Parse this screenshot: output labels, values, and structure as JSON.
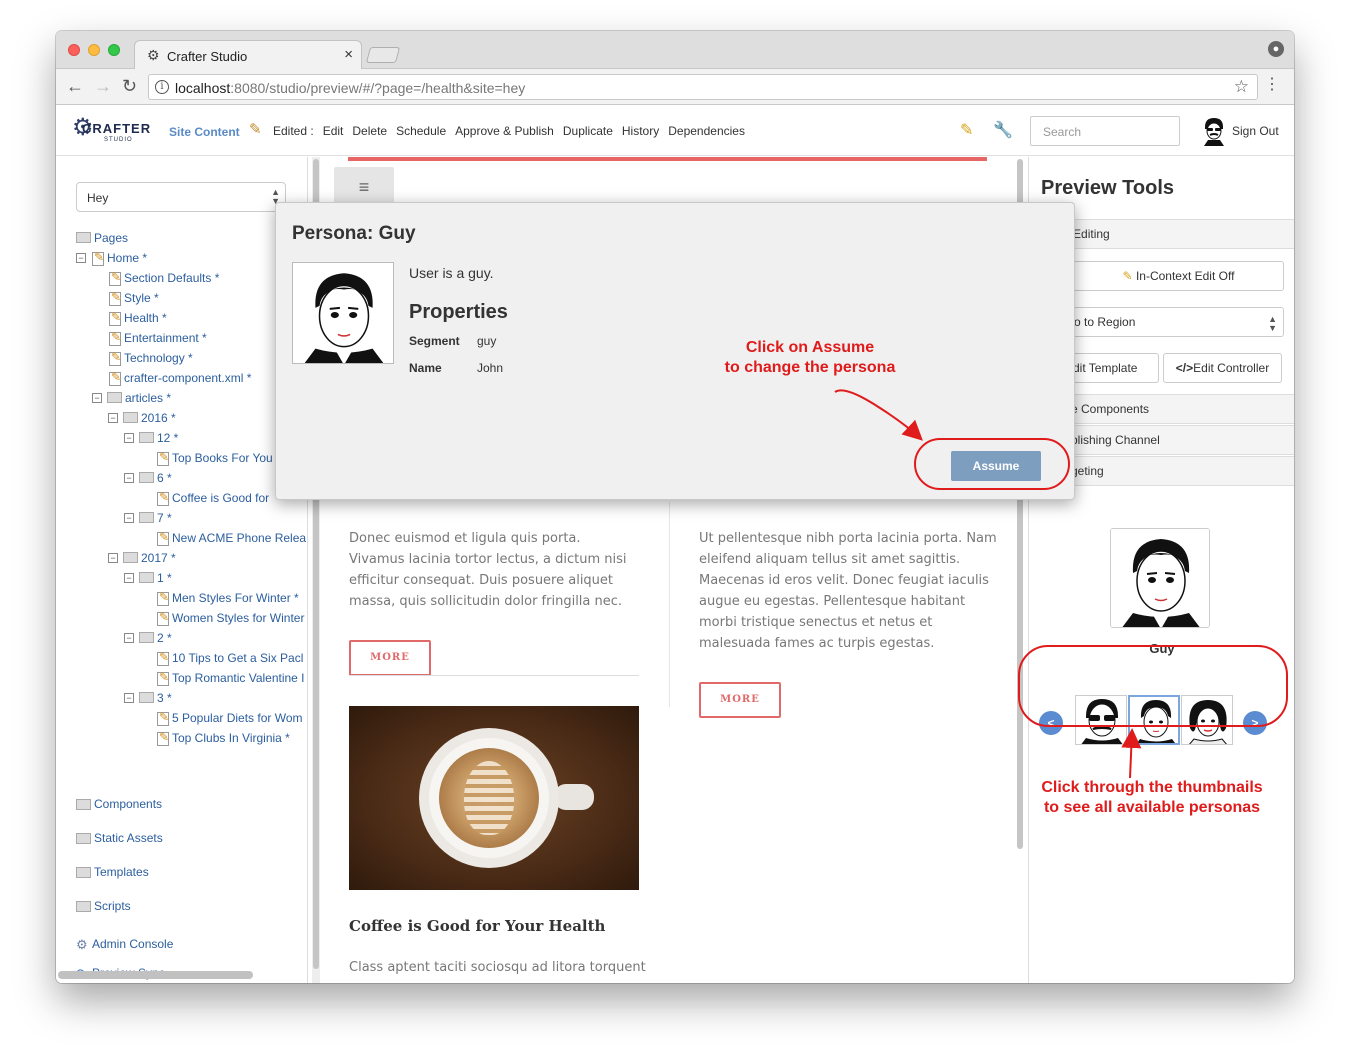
{
  "browser": {
    "tab_title": "Crafter Studio",
    "tab_close": "×",
    "url_host": "localhost",
    "url_rest": ":8080/studio/preview/#/?page=/health&site=hey",
    "info_glyph": "i",
    "star_glyph": "☆",
    "menu_glyph": "⋮",
    "back_glyph": "←",
    "forward_glyph": "→",
    "reload_glyph": "C"
  },
  "studio": {
    "logo_text": "CRAFTER",
    "logo_sub": "STUDIO",
    "site_content": "Site Content",
    "toolbar": [
      "Edited :",
      "Edit",
      "Delete",
      "Schedule",
      "Approve & Publish",
      "Duplicate",
      "History",
      "Dependencies"
    ],
    "search_placeholder": "Search",
    "sign_out": "Sign Out"
  },
  "sidebar": {
    "site_value": "Hey",
    "tree": [
      {
        "label": "Pages",
        "type": "folder",
        "level": 0,
        "expander": ""
      },
      {
        "label": "Home *",
        "type": "page",
        "level": 0,
        "expander": "−"
      },
      {
        "label": "Section Defaults *",
        "type": "page",
        "level": 1,
        "expander": ""
      },
      {
        "label": "Style *",
        "type": "page",
        "level": 1,
        "expander": ""
      },
      {
        "label": "Health *",
        "type": "page",
        "level": 1,
        "expander": ""
      },
      {
        "label": "Entertainment *",
        "type": "page",
        "level": 1,
        "expander": ""
      },
      {
        "label": "Technology *",
        "type": "page",
        "level": 1,
        "expander": ""
      },
      {
        "label": "crafter-component.xml *",
        "type": "page",
        "level": 1,
        "expander": ""
      },
      {
        "label": "articles *",
        "type": "folder",
        "level": 1,
        "expander": "−"
      },
      {
        "label": "2016 *",
        "type": "folder",
        "level": 2,
        "expander": "−"
      },
      {
        "label": "12 *",
        "type": "folder",
        "level": 3,
        "expander": "−"
      },
      {
        "label": "Top Books For You",
        "type": "page",
        "level": 4,
        "expander": ""
      },
      {
        "label": "6 *",
        "type": "folder",
        "level": 3,
        "expander": "−"
      },
      {
        "label": "Coffee is Good for",
        "type": "page",
        "level": 4,
        "expander": ""
      },
      {
        "label": "7 *",
        "type": "folder",
        "level": 3,
        "expander": "−"
      },
      {
        "label": "New ACME Phone Relea",
        "type": "page",
        "level": 4,
        "expander": ""
      },
      {
        "label": "2017 *",
        "type": "folder",
        "level": 2,
        "expander": "−"
      },
      {
        "label": "1 *",
        "type": "folder",
        "level": 3,
        "expander": "−"
      },
      {
        "label": "Men Styles For Winter *",
        "type": "page",
        "level": 4,
        "expander": ""
      },
      {
        "label": "Women Styles for Winter",
        "type": "page",
        "level": 4,
        "expander": ""
      },
      {
        "label": "2 *",
        "type": "folder",
        "level": 3,
        "expander": "−"
      },
      {
        "label": "10 Tips to Get a Six Pacl",
        "type": "page",
        "level": 4,
        "expander": ""
      },
      {
        "label": "Top Romantic Valentine I",
        "type": "page",
        "level": 4,
        "expander": ""
      },
      {
        "label": "3 *",
        "type": "folder",
        "level": 3,
        "expander": "−"
      },
      {
        "label": "5 Popular Diets for Wom",
        "type": "page",
        "level": 4,
        "expander": ""
      },
      {
        "label": "Top Clubs In Virginia *",
        "type": "page",
        "level": 4,
        "expander": ""
      }
    ],
    "sections": [
      "Components",
      "Static Assets",
      "Templates",
      "Scripts"
    ],
    "admin_console": "Admin Console",
    "preview_sync": "Preview Sync"
  },
  "preview": {
    "menu_glyph": "≡",
    "col1_text": "Donec euismod et ligula quis porta. Vivamus lacinia tortor lectus, a dictum nisi efficitur consequat. Duis posuere aliquet massa, quis sollicitudin dolor fringilla nec.",
    "col2_text": "Ut pellentesque nibh porta lacinia porta. Nam eleifend aliquam tellus sit amet sagittis. Maecenas id eros velit. Donec feugiat iaculis augue eu egestas. Pellentesque habitant morbi tristique senectus et netus et malesuada fames ac turpis egestas.",
    "more_label": "MORE",
    "article_title": "Coffee is Good for Your Health",
    "article_excerpt": "Class aptent taciti sociosqu ad litora torquent"
  },
  "preview_tools": {
    "title": "Preview Tools",
    "in_context_section": "ontext Editing",
    "in_context_button": "In-Context Edit Off",
    "region_select": "o to Region",
    "edit_template": "dit Template",
    "edit_controller": "Edit Controller",
    "sections": [
      "e Components",
      "blishing Channel",
      "geting"
    ],
    "persona_name": "Guy",
    "prev_glyph": "<",
    "next_glyph": ">"
  },
  "modal": {
    "title": "Persona: Guy",
    "description": "User is a guy.",
    "properties_heading": "Properties",
    "properties": [
      {
        "label": "Segment",
        "value": "guy"
      },
      {
        "label": "Name",
        "value": "John"
      }
    ],
    "assume_button": "Assume"
  },
  "annotations": {
    "assume_callout": [
      "Click on Assume",
      "to change the persona"
    ],
    "thumbs_callout": [
      "Click through the thumbnails",
      "to see all available personas"
    ]
  },
  "colors": {
    "annotation_red": "#e01b1b",
    "link_blue": "#2c5e9e",
    "accent_red": "#e06a6a",
    "assume_blue": "#7e9ebf"
  }
}
